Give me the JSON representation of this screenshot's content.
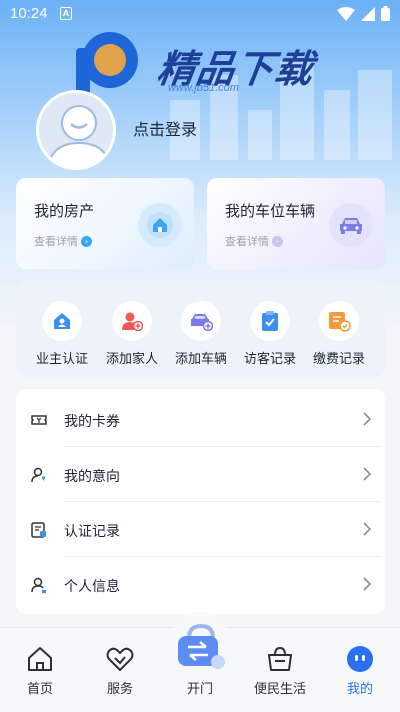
{
  "status_bar": {
    "time": "10:24",
    "notification_letter": "A"
  },
  "watermark": {
    "brand": "精品下载",
    "url": "www.jb51.com"
  },
  "profile": {
    "login_text": "点击登录"
  },
  "cards": [
    {
      "title": "我的房产",
      "subtitle": "查看详情",
      "icon": "house-icon",
      "color": "#3aa6f0"
    },
    {
      "title": "我的车位车辆",
      "subtitle": "查看详情",
      "icon": "car-icon",
      "color": "#7a7de8"
    }
  ],
  "quick_actions": [
    {
      "label": "业主认证",
      "icon": "owner-verify-icon"
    },
    {
      "label": "添加家人",
      "icon": "add-family-icon"
    },
    {
      "label": "添加车辆",
      "icon": "add-vehicle-icon"
    },
    {
      "label": "访客记录",
      "icon": "visitor-record-icon"
    },
    {
      "label": "缴费记录",
      "icon": "payment-record-icon"
    }
  ],
  "menu": [
    {
      "label": "我的卡券",
      "icon": "coupon-icon"
    },
    {
      "label": "我的意向",
      "icon": "intention-icon"
    },
    {
      "label": "认证记录",
      "icon": "certification-record-icon"
    },
    {
      "label": "个人信息",
      "icon": "personal-info-icon"
    }
  ],
  "tabbar": {
    "items": [
      {
        "label": "首页",
        "icon": "home-icon"
      },
      {
        "label": "服务",
        "icon": "service-handshake-icon"
      },
      {
        "label": "开门",
        "icon": "open-door-icon"
      },
      {
        "label": "便民生活",
        "icon": "shopping-bag-icon"
      },
      {
        "label": "我的",
        "icon": "profile-face-icon"
      }
    ],
    "active": "我的",
    "active_color": "#2a6ff1"
  }
}
